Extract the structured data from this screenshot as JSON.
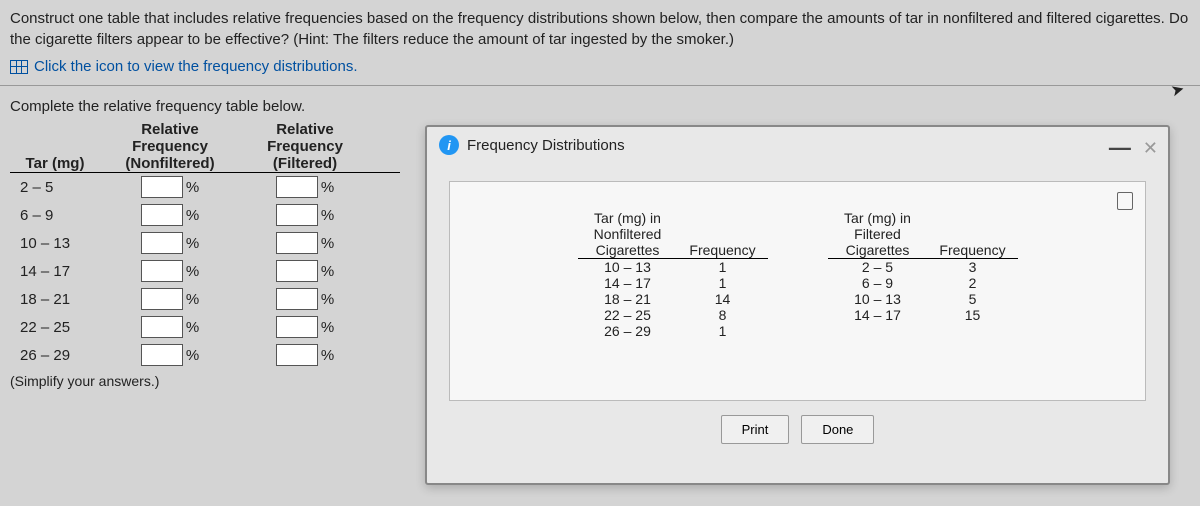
{
  "question": "Construct one table that includes relative frequencies based on the frequency distributions shown below, then compare the amounts of tar in nonfiltered and filtered cigarettes. Do the cigarette filters appear to be effective? (Hint: The filters reduce the amount of tar ingested by the smoker.)",
  "viewLink": "Click the icon to view the frequency distributions.",
  "prompt": "Complete the relative frequency table below.",
  "leftTable": {
    "headers": {
      "col1": "Tar (mg)",
      "col2_line1": "Relative",
      "col2_line2": "Frequency",
      "col2_line3": "(Nonfiltered)",
      "col3_line1": "Relative",
      "col3_line2": "Frequency",
      "col3_line3": "(Filtered)"
    },
    "rows": [
      {
        "range": "2 – 5"
      },
      {
        "range": "6 – 9"
      },
      {
        "range": "10 – 13"
      },
      {
        "range": "14 – 17"
      },
      {
        "range": "18 – 21"
      },
      {
        "range": "22 – 25"
      },
      {
        "range": "26 – 29"
      }
    ],
    "percent": "%"
  },
  "simplify": "(Simplify your answers.)",
  "modal": {
    "title": "Frequency Distributions",
    "print": "Print",
    "done": "Done"
  },
  "chart_data": [
    {
      "type": "table",
      "title": "Tar (mg) in Nonfiltered Cigarettes",
      "headers": {
        "c1_l1": "Tar (mg) in",
        "c1_l2": "Nonfiltered",
        "c1_l3": "Cigarettes",
        "c2": "Frequency"
      },
      "rows": [
        {
          "range": "10 – 13",
          "freq": "1"
        },
        {
          "range": "14 – 17",
          "freq": "1"
        },
        {
          "range": "18 – 21",
          "freq": "14"
        },
        {
          "range": "22 – 25",
          "freq": "8"
        },
        {
          "range": "26 – 29",
          "freq": "1"
        }
      ]
    },
    {
      "type": "table",
      "title": "Tar (mg) in Filtered Cigarettes",
      "headers": {
        "c1_l1": "Tar (mg) in",
        "c1_l2": "Filtered",
        "c1_l3": "Cigarettes",
        "c2": "Frequency"
      },
      "rows": [
        {
          "range": "2 – 5",
          "freq": "3"
        },
        {
          "range": "6 – 9",
          "freq": "2"
        },
        {
          "range": "10 – 13",
          "freq": "5"
        },
        {
          "range": "14 – 17",
          "freq": "15"
        }
      ]
    }
  ]
}
